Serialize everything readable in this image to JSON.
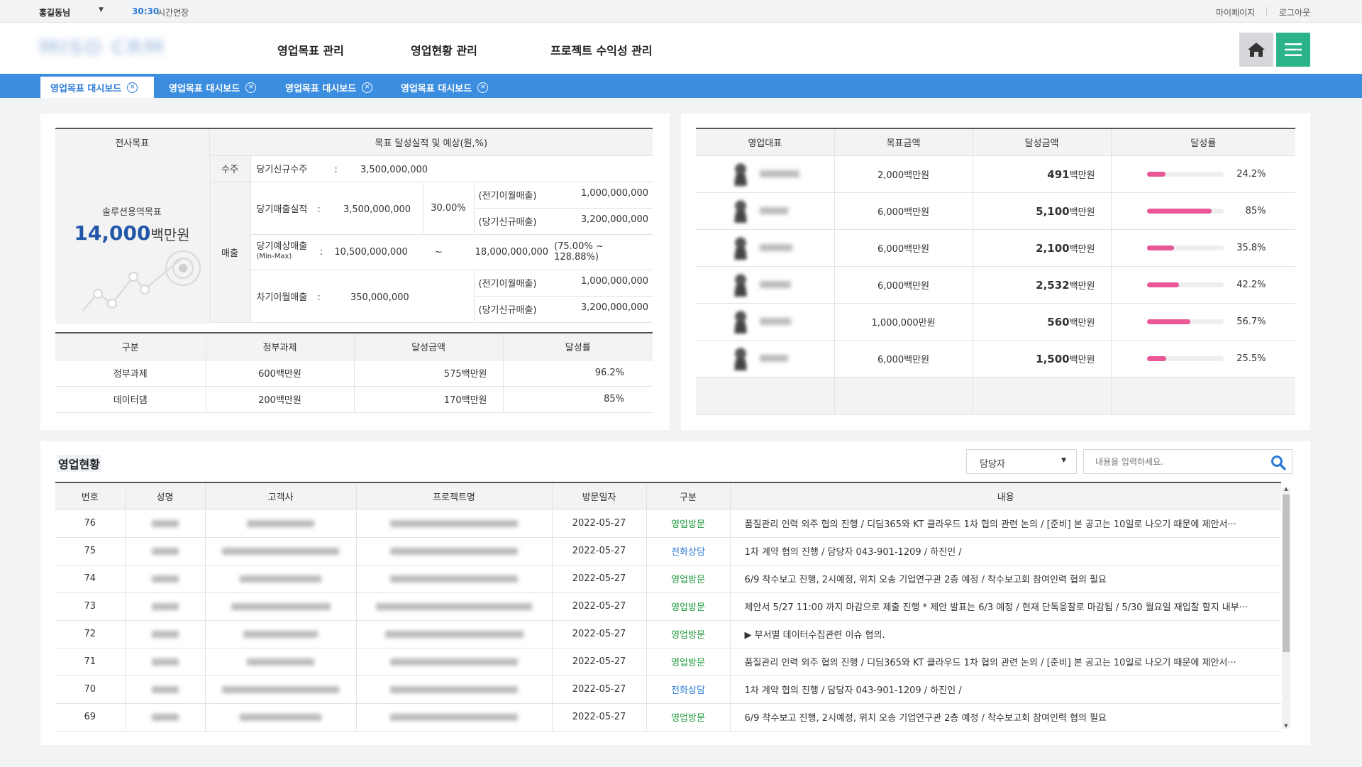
{
  "topbar": {
    "user": "홍길동님",
    "timer": "30:30",
    "extend": "시간연장",
    "mypage": "마이페이지",
    "logout": "로그아웃"
  },
  "header": {
    "logo": "MISO CRM",
    "nav": [
      "영업목표 관리",
      "영업현황 관리",
      "프로젝트 수익성 관리"
    ]
  },
  "tabs": [
    "영업목표 대시보드",
    "영업목표 대시보드",
    "영업목표 대시보드",
    "영업목표 대시보드"
  ],
  "goal": {
    "col1": "전사목표",
    "col2": "목표 달성실적 및 예상(원,%)",
    "target_label": "솔루션용역목표",
    "target_value": "14,000",
    "target_unit": "백만원",
    "order_label": "수주",
    "order_item": "당기신규수주",
    "colon": ":",
    "order_value": "3,500,000,000",
    "sales_label": "매출",
    "actual_label": "당기매출실적",
    "actual_value": "3,500,000,000",
    "actual_rate": "30.00%",
    "prev_label": "(전기이월매출)",
    "prev_value": "1,000,000,000",
    "new_label": "(당기신규매출)",
    "new_value": "3,200,000,000",
    "forecast_label": "당기예상매출",
    "forecast_sub": "(Min-Max)",
    "forecast_min": "10,500,000,000",
    "tilde": "~",
    "forecast_max": "18,000,000,000",
    "forecast_range": "(75.00% ~ 128.88%)",
    "next_label": "차기이월매출",
    "next_value": "350,000,000",
    "next_prev_label": "(전기이월매출)",
    "next_prev_value": "1,000,000,000",
    "next_new_label": "(당기신규매출)",
    "next_new_value": "3,200,000,000"
  },
  "gov": {
    "headers": [
      "구분",
      "정부과제",
      "달성금액",
      "달성률"
    ],
    "rows": [
      [
        "정부과제",
        "600백만원",
        "575백만원",
        "96.2%"
      ],
      [
        "데이터댐",
        "200백만원",
        "170백만원",
        "85%"
      ]
    ]
  },
  "reps": {
    "headers": [
      "영업대표",
      "목표금액",
      "달성금액",
      "달성률"
    ],
    "rows": [
      {
        "target": "2,000백만원",
        "amount": "491",
        "unit": "백만원",
        "rate": "24.2%",
        "pct": 24.2
      },
      {
        "target": "6,000백만원",
        "amount": "5,100",
        "unit": "백만원",
        "rate": "85%",
        "pct": 85
      },
      {
        "target": "6,000백만원",
        "amount": "2,100",
        "unit": "백만원",
        "rate": "35.8%",
        "pct": 35.8
      },
      {
        "target": "6,000백만원",
        "amount": "2,532",
        "unit": "백만원",
        "rate": "42.2%",
        "pct": 42.2
      },
      {
        "target": "1,000,000만원",
        "amount": "560",
        "unit": "백만원",
        "rate": "56.7%",
        "pct": 56.7
      },
      {
        "target": "6,000백만원",
        "amount": "1,500",
        "unit": "백만원",
        "rate": "25.5%",
        "pct": 25.5
      }
    ],
    "bar_color": "#e95796"
  },
  "status": {
    "title": "영업현황",
    "select": "담당자",
    "search_placeholder": "내용을 입력하세요.",
    "headers": [
      "번호",
      "성명",
      "고객사",
      "프로젝트명",
      "방문일자",
      "구분",
      "내용"
    ],
    "rows": [
      {
        "no": "76",
        "date": "2022-05-27",
        "type": "영업방문",
        "kind": "visit",
        "content": "품질관리 인력 외주 협의 진행 / 디딤365와 KT 클라우드 1차 협의 관련 논의 / [준비] 본 공고는 10일로 나오기 때문에 제안서···"
      },
      {
        "no": "75",
        "date": "2022-05-27",
        "type": "전화상담",
        "kind": "call",
        "content": "1차 계약 협의 진행 / 담당자 043-901-1209 / 하진인 /"
      },
      {
        "no": "74",
        "date": "2022-05-27",
        "type": "영업방문",
        "kind": "visit",
        "content": "6/9 착수보고 진행, 2시예정, 위치 오송 기업연구관 2층 예정 / 착수보고회 참여인력 협의 필요"
      },
      {
        "no": "73",
        "date": "2022-05-27",
        "type": "영업방문",
        "kind": "visit",
        "content": "제안서 5/27 11:00 까지 마감으로 제출 진행 * 제안 발표는 6/3 예정 / 현재 단독응찰로 마감됨 / 5/30 월요일 재입찰 할지 내부···"
      },
      {
        "no": "72",
        "date": "2022-05-27",
        "type": "영업방문",
        "kind": "visit",
        "content": "▶ 부서별 데이터수집관련 이슈 협의."
      },
      {
        "no": "71",
        "date": "2022-05-27",
        "type": "영업방문",
        "kind": "visit",
        "content": "품질관리 인력 외주 협의 진행 / 디딤365와 KT 클라우드 1차 협의 관련 논의 / [준비] 본 공고는 10일로 나오기 때문에 제안서···"
      },
      {
        "no": "70",
        "date": "2022-05-27",
        "type": "전화상담",
        "kind": "call",
        "content": "1차 계약 협의 진행 / 담당자 043-901-1209 / 하진인 /"
      },
      {
        "no": "69",
        "date": "2022-05-27",
        "type": "영업방문",
        "kind": "visit",
        "content": "6/9 착수보고 진행, 2시예정, 위치 오송 기업연구관 2층 예정 / 착수보고회 참여인력 협의 필요"
      }
    ]
  },
  "icons": {
    "home": "home-icon",
    "menu": "hamburger-menu-icon",
    "close": "close-circle-icon",
    "search": "search-icon",
    "caret": "caret-down-icon"
  },
  "colors": {
    "accent": "#3b8de0",
    "menu_button": "#2bb48c",
    "visit": "#1e9b3d",
    "call": "#2d7bd6",
    "progress": "#e95796"
  }
}
